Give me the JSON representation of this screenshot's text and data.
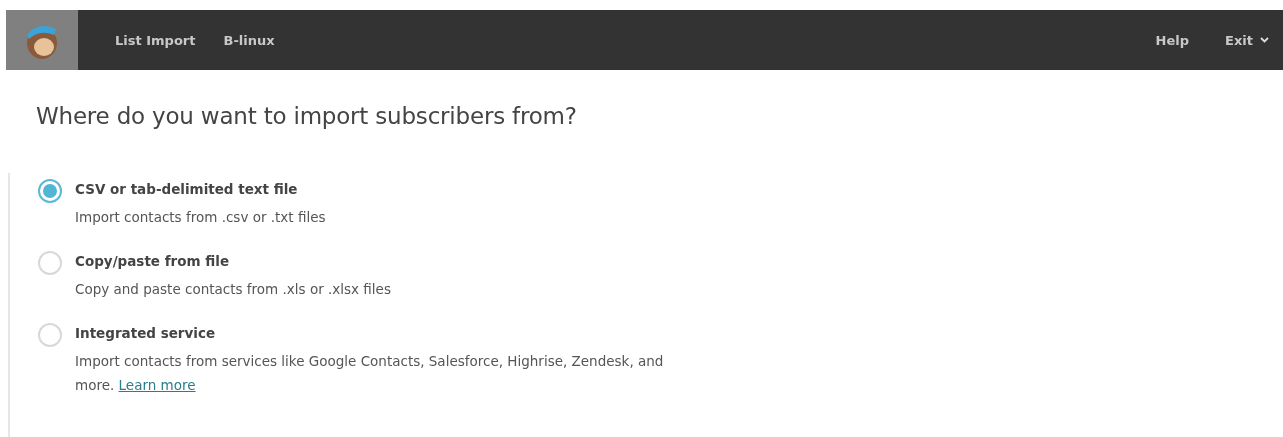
{
  "topbar": {
    "nav": [
      "List Import",
      "B-linux"
    ],
    "right": [
      {
        "label": "Help",
        "kind": "link"
      },
      {
        "label": "Exit",
        "kind": "menu"
      }
    ]
  },
  "heading": "Where do you want to import subscribers from?",
  "options": [
    {
      "title": "CSV or tab-delimited text file",
      "description": "Import contacts from .csv or .txt files",
      "selected": true
    },
    {
      "title": "Copy/paste from file",
      "description": "Copy and paste contacts from .xls or .xlsx files",
      "selected": false
    },
    {
      "title": "Integrated service",
      "description": "Import contacts from services like Google Contacts, Salesforce, Highrise, Zendesk, and more.",
      "link": "Learn more",
      "selected": false
    }
  ]
}
